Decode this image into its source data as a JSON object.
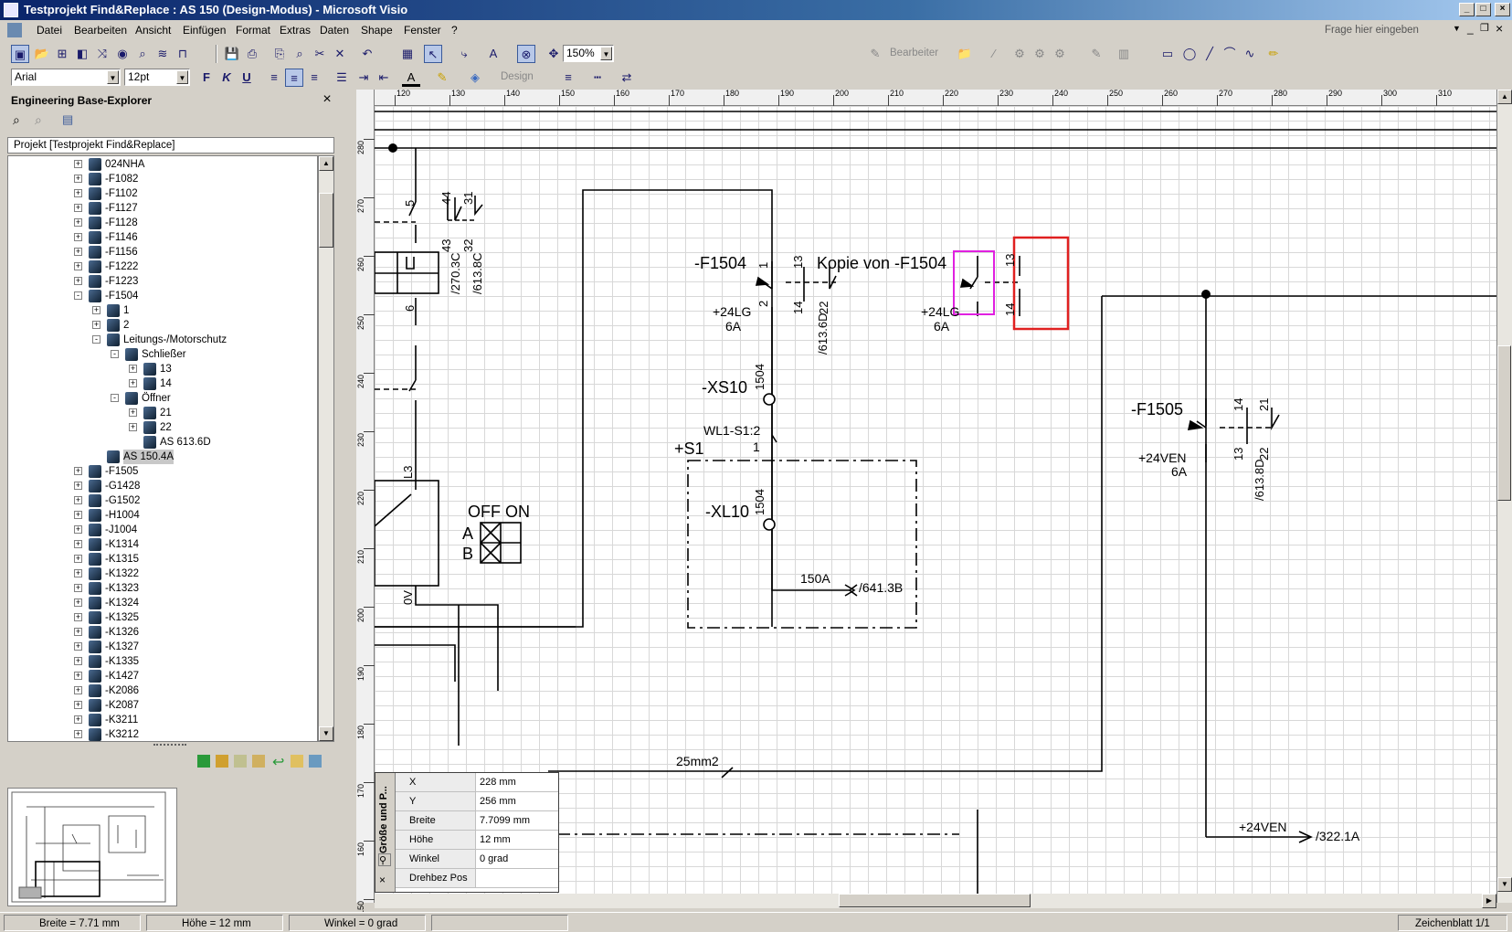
{
  "window": {
    "title": "Testprojekt Find&Replace : AS 150 (Design-Modus) - Microsoft Visio",
    "min": "_",
    "max": "□",
    "close": "×"
  },
  "menu": {
    "items": [
      "Datei",
      "Bearbeiten",
      "Ansicht",
      "Einfügen",
      "Format",
      "Extras",
      "Daten",
      "Shape",
      "Fenster",
      "?"
    ],
    "help_placeholder": "Frage hier eingeben"
  },
  "toolbar": {
    "zoom": "150%",
    "font": "Arial",
    "size": "12pt",
    "bearbeiter": "Bearbeiter",
    "design": "Design",
    "bold": "F",
    "italic": "K",
    "underline": "U"
  },
  "explorer": {
    "title": "Engineering Base-Explorer",
    "root": "Projekt [Testprojekt Find&Replace]",
    "nodes": [
      {
        "label": "024NHA",
        "level": 0,
        "exp": "+"
      },
      {
        "label": "-F1082",
        "level": 0,
        "exp": "+"
      },
      {
        "label": "-F1102",
        "level": 0,
        "exp": "+"
      },
      {
        "label": "-F1127",
        "level": 0,
        "exp": "+"
      },
      {
        "label": "-F1128",
        "level": 0,
        "exp": "+"
      },
      {
        "label": "-F1146",
        "level": 0,
        "exp": "+"
      },
      {
        "label": "-F1156",
        "level": 0,
        "exp": "+"
      },
      {
        "label": "-F1222",
        "level": 0,
        "exp": "+"
      },
      {
        "label": "-F1223",
        "level": 0,
        "exp": "+"
      },
      {
        "label": "-F1504",
        "level": 0,
        "exp": "-"
      },
      {
        "label": "1",
        "level": 1,
        "exp": "+"
      },
      {
        "label": "2",
        "level": 1,
        "exp": "+"
      },
      {
        "label": "Leitungs-/Motorschutz",
        "level": 1,
        "exp": "-"
      },
      {
        "label": "Schließer",
        "level": 2,
        "exp": "-"
      },
      {
        "label": "13",
        "level": 3,
        "exp": "+"
      },
      {
        "label": "14",
        "level": 3,
        "exp": "+"
      },
      {
        "label": "Öffner",
        "level": 2,
        "exp": "-"
      },
      {
        "label": "21",
        "level": 3,
        "exp": "+"
      },
      {
        "label": "22",
        "level": 3,
        "exp": "+"
      },
      {
        "label": "AS 613.6D",
        "level": 3,
        "exp": ""
      },
      {
        "label": "AS 150.4A",
        "level": 1,
        "exp": "",
        "sel": true
      },
      {
        "label": "-F1505",
        "level": 0,
        "exp": "+"
      },
      {
        "label": "-G1428",
        "level": 0,
        "exp": "+"
      },
      {
        "label": "-G1502",
        "level": 0,
        "exp": "+"
      },
      {
        "label": "-H1004",
        "level": 0,
        "exp": "+"
      },
      {
        "label": "-J1004",
        "level": 0,
        "exp": "+"
      },
      {
        "label": "-K1314",
        "level": 0,
        "exp": "+"
      },
      {
        "label": "-K1315",
        "level": 0,
        "exp": "+"
      },
      {
        "label": "-K1322",
        "level": 0,
        "exp": "+"
      },
      {
        "label": "-K1323",
        "level": 0,
        "exp": "+"
      },
      {
        "label": "-K1324",
        "level": 0,
        "exp": "+"
      },
      {
        "label": "-K1325",
        "level": 0,
        "exp": "+"
      },
      {
        "label": "-K1326",
        "level": 0,
        "exp": "+"
      },
      {
        "label": "-K1327",
        "level": 0,
        "exp": "+"
      },
      {
        "label": "-K1335",
        "level": 0,
        "exp": "+"
      },
      {
        "label": "-K1427",
        "level": 0,
        "exp": "+"
      },
      {
        "label": "-K2086",
        "level": 0,
        "exp": "+"
      },
      {
        "label": "-K2087",
        "level": 0,
        "exp": "+"
      },
      {
        "label": "-K3211",
        "level": 0,
        "exp": "+"
      },
      {
        "label": "-K3212",
        "level": 0,
        "exp": "+"
      }
    ]
  },
  "ruler": {
    "h_ticks": [
      "120",
      "130",
      "140",
      "150",
      "160",
      "170",
      "180",
      "190",
      "200",
      "210",
      "220",
      "230",
      "240",
      "250",
      "260",
      "270",
      "280",
      "290",
      "300",
      "310"
    ],
    "v_ticks": [
      "280",
      "270",
      "260",
      "250",
      "240",
      "230",
      "220",
      "210",
      "200",
      "190",
      "180",
      "170",
      "160",
      "150"
    ]
  },
  "drawing": {
    "labels": {
      "f1504": "-F1504",
      "kopie": "Kopie von -F1504",
      "f1505": "-F1505",
      "xs10": "-XS10",
      "xl10": "-XL10",
      "s1": "+S1",
      "wl1": "WL1-S1:2",
      "one": "1",
      "lg24a": "+24LG",
      "lg24b": "+24LG",
      "amp6a": "6A",
      "amp6b": "6A",
      "amp6c": "6A",
      "ven24": "+24VEN",
      "ven24b": "+24VEN",
      "ref322": "/322.1A",
      "a150": "150A",
      "ref641": "/641.3B",
      "mm25": "25mm2",
      "offon": "OFF ON",
      "a": "A",
      "b": "B",
      "ref6136d": "/613.6D",
      "ref6138d": "/613.8D",
      "ref2703c": "/270.3C",
      "ref6138c": "/613.8C",
      "n1504a": "1504",
      "n1504b": "1504",
      "l3": "L3",
      "ov": "0V",
      "p1": "1",
      "p2": "2",
      "p13": "13",
      "p14": "14",
      "p21": "21",
      "p22": "22",
      "p5": "5",
      "p6": "6",
      "p44": "44",
      "p31": "31",
      "p43": "43",
      "p32": "32"
    }
  },
  "size_panel": {
    "tab": "Größe und P...",
    "rows": [
      {
        "k": "X",
        "v": "228 mm"
      },
      {
        "k": "Y",
        "v": "256 mm"
      },
      {
        "k": "Breite",
        "v": "7.7099 mm"
      },
      {
        "k": "Höhe",
        "v": "12 mm"
      },
      {
        "k": "Winkel",
        "v": "0 grad"
      },
      {
        "k": "Drehbez Pos",
        "v": ""
      }
    ]
  },
  "status": {
    "breite": "Breite = 7.71 mm",
    "hoehe": "Höhe = 12 mm",
    "winkel": "Winkel = 0 grad",
    "sheet": "Zeichenblatt 1/1"
  }
}
